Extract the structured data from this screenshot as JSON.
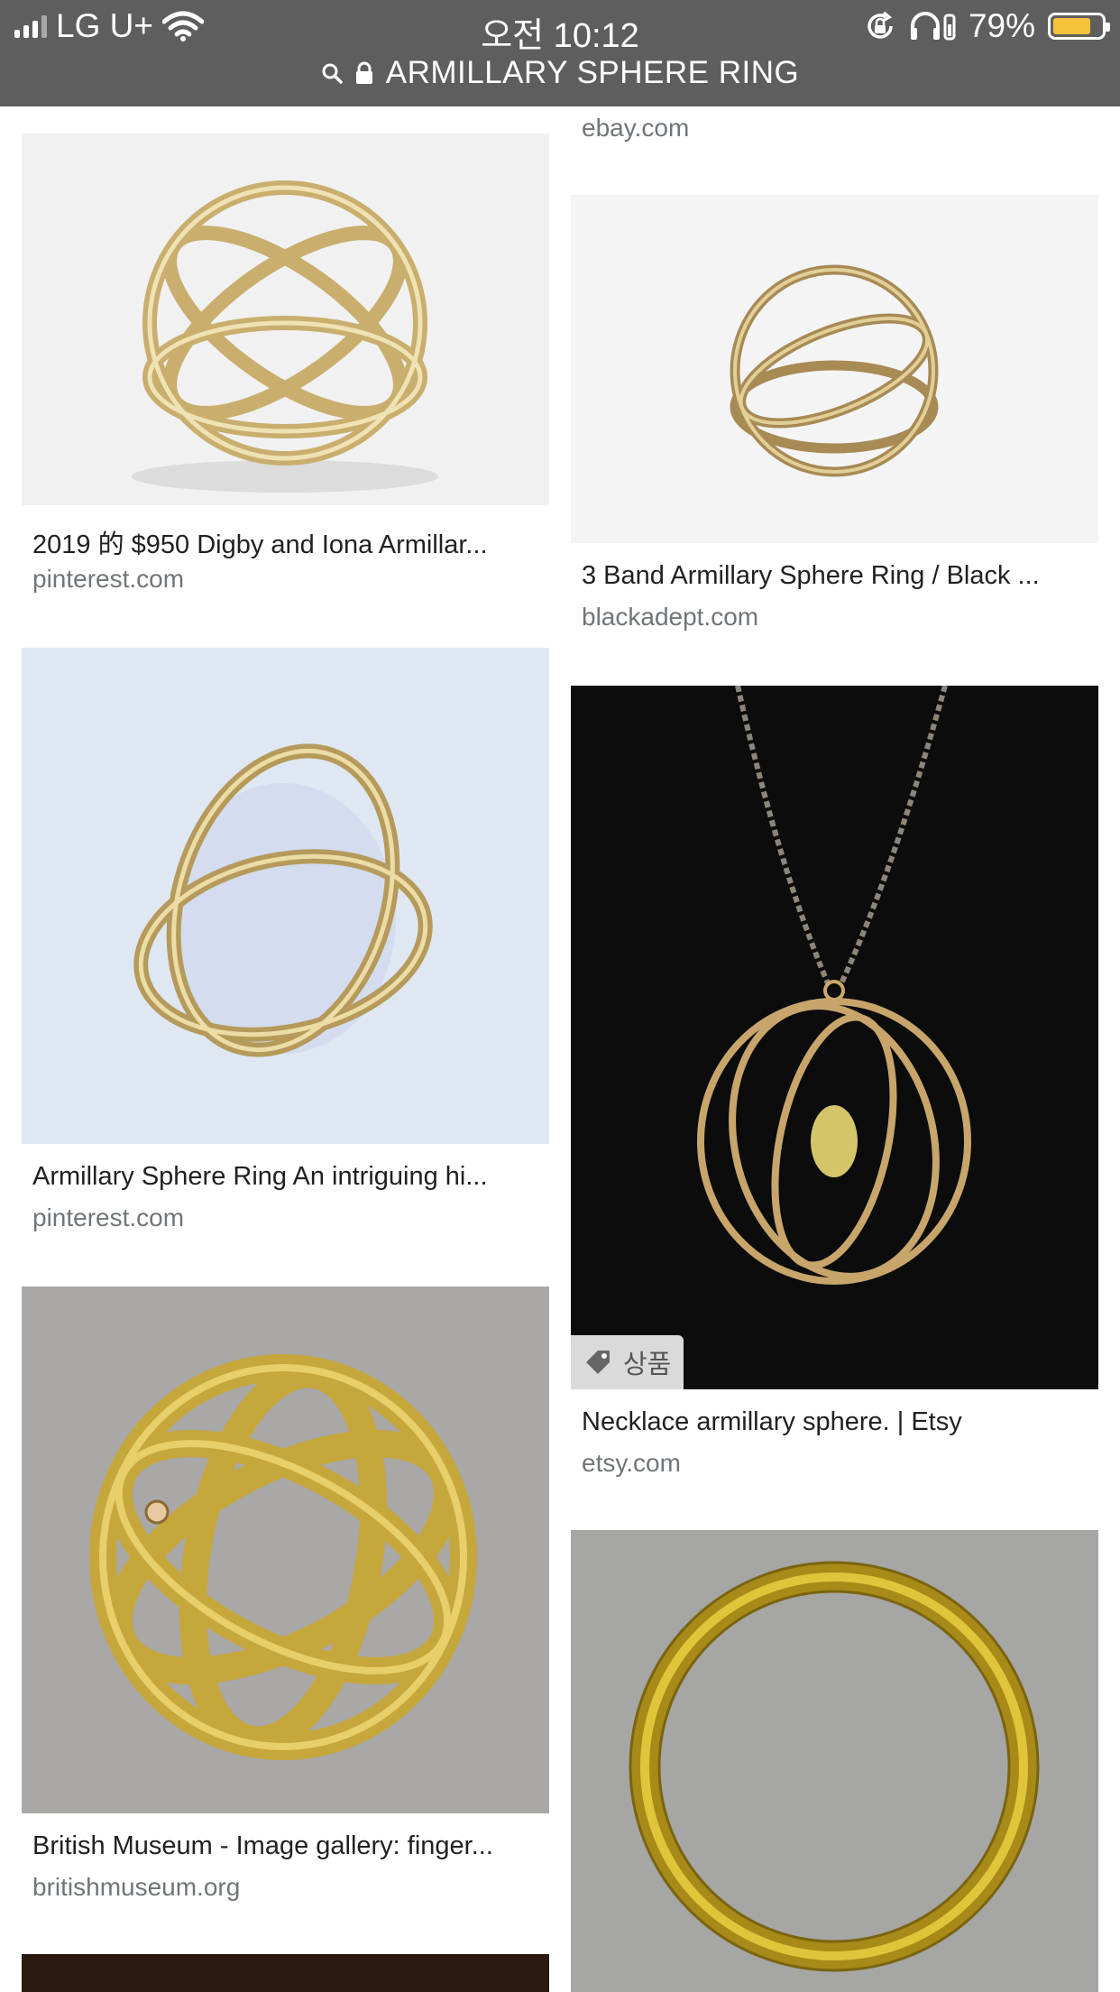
{
  "status_bar": {
    "carrier": "LG U+",
    "time": "오전 10:12",
    "battery": "79%",
    "battery_level": 0.79
  },
  "url_bar": {
    "query": "ARMILLARY SPHERE RING"
  },
  "results": [
    {
      "title": "",
      "source": "ebay.com"
    },
    {
      "title": "2019 的 $950 Digby and Iona Armillar...",
      "source": "pinterest.com"
    },
    {
      "title": "3 Band Armillary Sphere Ring / Black ...",
      "source": "blackadept.com"
    },
    {
      "title": "Armillary Sphere Ring An intriguing hi...",
      "source": "pinterest.com"
    },
    {
      "title": "Necklace armillary sphere. | Etsy",
      "source": "etsy.com",
      "badge": "상품"
    },
    {
      "title": "British Museum - Image gallery: finger...",
      "source": "britishmuseum.org"
    }
  ],
  "colors": {
    "topbar": "#5e5e5e",
    "title_text": "#202124",
    "source_text": "#70757a",
    "battery_fill": "#f5c33b"
  },
  "icons": [
    "wifi-icon",
    "search-icon",
    "lock-icon",
    "orientation-lock-icon",
    "headphones-icon",
    "battery-icon",
    "tag-icon"
  ]
}
